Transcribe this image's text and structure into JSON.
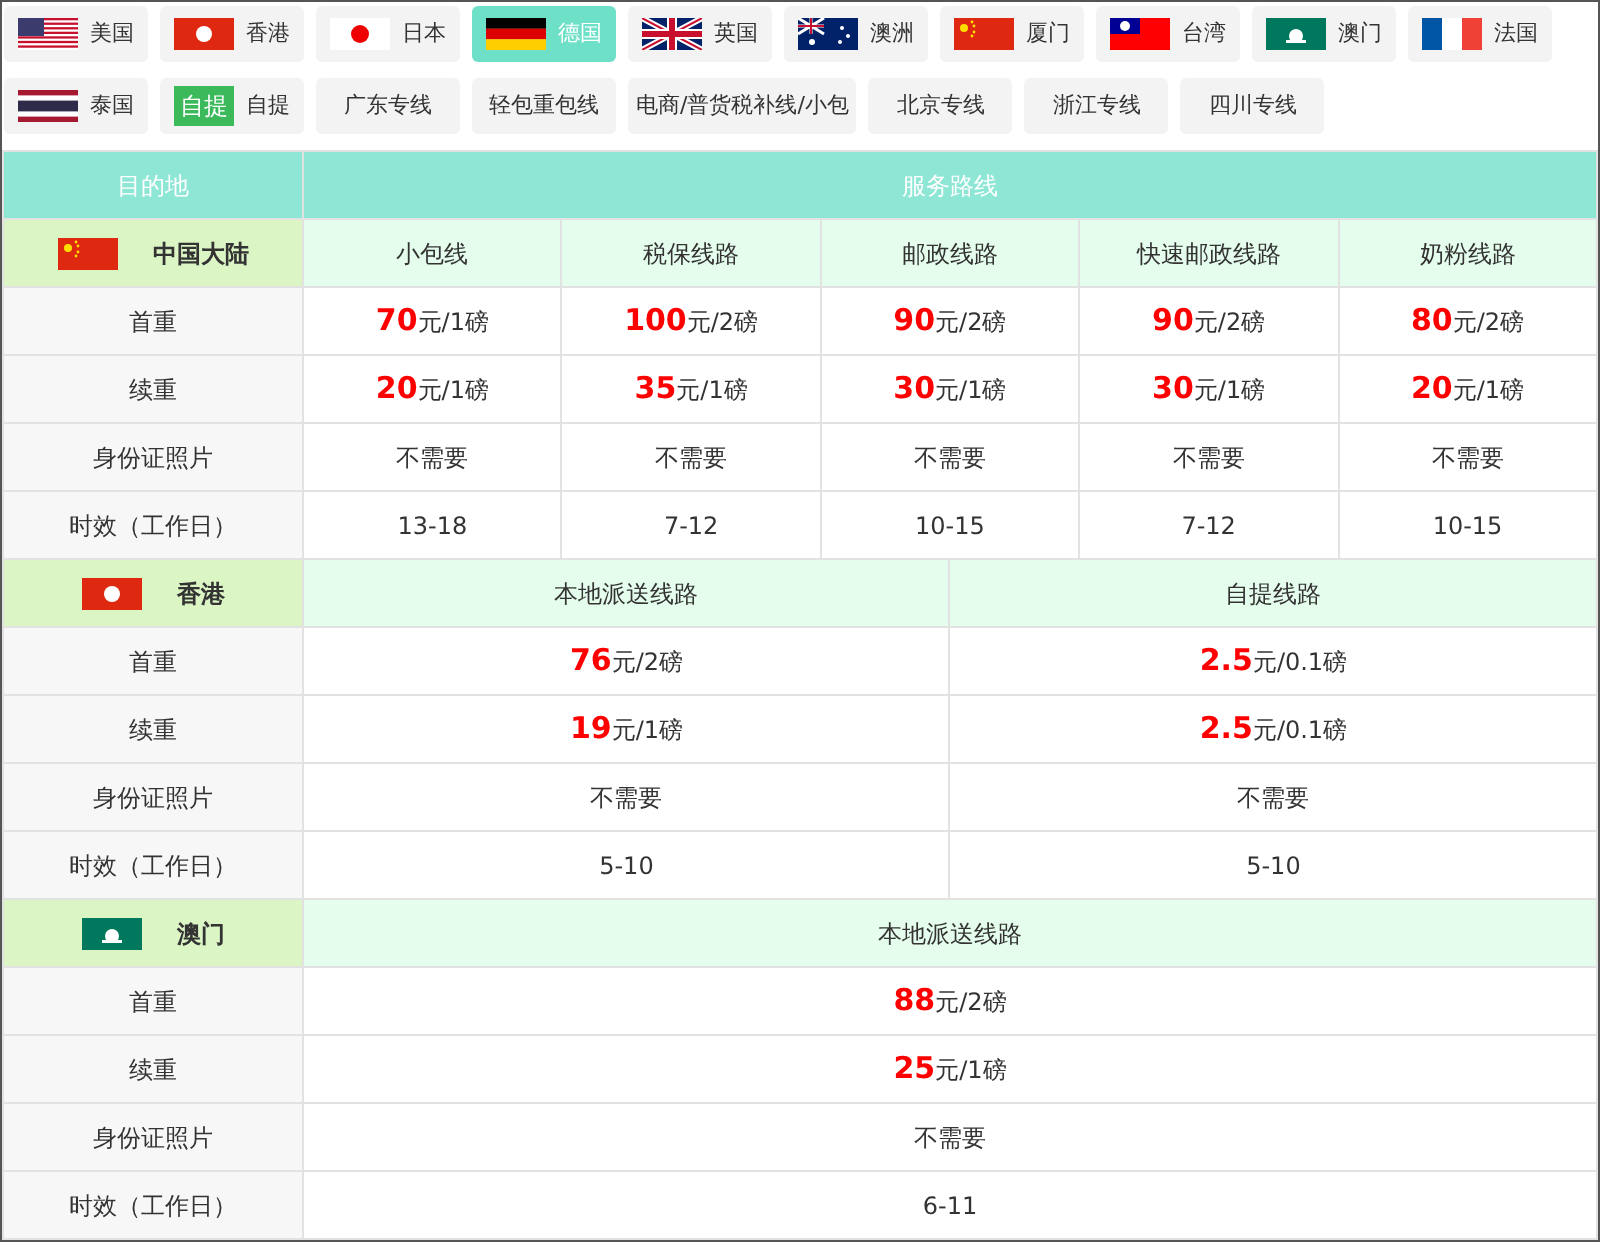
{
  "tabs": [
    {
      "label": "美国",
      "kind": "us",
      "selected": false
    },
    {
      "label": "香港",
      "kind": "hk",
      "selected": false
    },
    {
      "label": "日本",
      "kind": "jp",
      "selected": false
    },
    {
      "label": "德国",
      "kind": "de",
      "selected": true
    },
    {
      "label": "英国",
      "kind": "uk",
      "selected": false
    },
    {
      "label": "澳洲",
      "kind": "au",
      "selected": false
    },
    {
      "label": "厦门",
      "kind": "cn",
      "selected": false
    },
    {
      "label": "台湾",
      "kind": "tw",
      "selected": false
    },
    {
      "label": "澳门",
      "kind": "mo",
      "selected": false
    },
    {
      "label": "法国",
      "kind": "fr",
      "selected": false
    },
    {
      "label": "泰国",
      "kind": "th",
      "selected": false
    },
    {
      "label": "自提",
      "badge": "自提",
      "selected": false
    },
    {
      "label": "广东专线",
      "selected": false
    },
    {
      "label": "轻包重包线",
      "selected": false
    },
    {
      "label": "电商/普货税补线/小包",
      "selected": false
    },
    {
      "label": "北京专线",
      "selected": false
    },
    {
      "label": "浙江专线",
      "selected": false
    },
    {
      "label": "四川专线",
      "selected": false
    }
  ],
  "table": {
    "columns": [
      "目的地",
      "服务路线"
    ],
    "sections": [
      {
        "name": "中国大陆",
        "kind": "cn",
        "routes": [
          "小包线",
          "税保线路",
          "邮政线路",
          "快速邮政线路",
          "奶粉线路"
        ],
        "rows": [
          {
            "label": "首重",
            "values": [
              "**70**元/1磅",
              "**100**元/2磅",
              "**90**元/2磅",
              "**90**元/2磅",
              "**80**元/2磅"
            ]
          },
          {
            "label": "续重",
            "values": [
              "**20**元/1磅",
              "**35**元/1磅",
              "**30**元/1磅",
              "**30**元/1磅",
              "**20**元/1磅"
            ]
          },
          {
            "label": "身份证照片",
            "values": [
              "不需要",
              "不需要",
              "不需要",
              "不需要",
              "不需要"
            ]
          },
          {
            "label": "时效（工作日）",
            "values": [
              "13-18",
              "7-12",
              "10-15",
              "7-12",
              "10-15"
            ]
          }
        ]
      },
      {
        "name": "香港",
        "kind": "hk",
        "routes": [
          "本地派送线路",
          "自提线路"
        ],
        "rows": [
          {
            "label": "首重",
            "values": [
              "**76**元/2磅",
              "**2.5**元/0.1磅"
            ]
          },
          {
            "label": "续重",
            "values": [
              "**19**元/1磅",
              "**2.5**元/0.1磅"
            ]
          },
          {
            "label": "身份证照片",
            "values": [
              "不需要",
              "不需要"
            ]
          },
          {
            "label": "时效（工作日）",
            "values": [
              "5-10",
              "5-10"
            ]
          }
        ]
      },
      {
        "name": "澳门",
        "kind": "mo",
        "routes": [
          "本地派送线路"
        ],
        "rows": [
          {
            "label": "首重",
            "values": [
              "**88**元/2磅"
            ]
          },
          {
            "label": "续重",
            "values": [
              "**25**元/1磅"
            ]
          },
          {
            "label": "身份证照片",
            "values": [
              "不需要"
            ]
          },
          {
            "label": "时效（工作日）",
            "values": [
              "6-11"
            ]
          }
        ]
      }
    ]
  }
}
